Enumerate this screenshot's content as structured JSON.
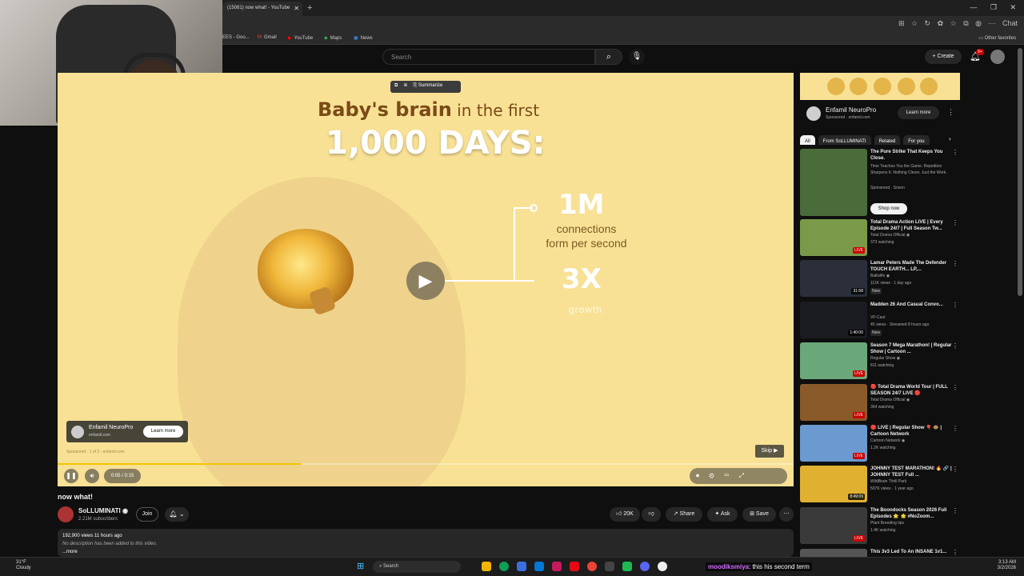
{
  "browser": {
    "tab_title": "(15081) now what! - YouTube",
    "new_tab": "+",
    "window_controls": "— ❐ ✕",
    "bookmarks": [
      {
        "label": "EES - Goo..."
      },
      {
        "label": "Gmail"
      },
      {
        "label": "YouTube"
      },
      {
        "label": "Maps"
      },
      {
        "label": "News"
      }
    ],
    "other_favorites": "Other favorites",
    "copilot_label": "Chat"
  },
  "header": {
    "search_placeholder": "Search",
    "create_label": "+ Create",
    "notification_count": "9+"
  },
  "video": {
    "toolbar": [
      "⧉",
      "⧈",
      "⎘ Summarize"
    ],
    "headline_bold": "Baby's brain",
    "headline_rest": " in the first",
    "big_title": "1,000 DAYS:",
    "stat1_value": "1M",
    "stat1_line1": "connections",
    "stat1_line2": "form per second",
    "stat2_value": "3X",
    "stat2_label": "growth",
    "ad_name": "Enfamil NeuroPro",
    "ad_url": "enfamil.com",
    "ad_learn": "Learn more",
    "ad_info": "Sponsored · 1 of 2 · enfamil.com",
    "skip_label": "Skip ▶",
    "time": "0:05 / 0:15",
    "progress_fraction": 0.33
  },
  "below": {
    "title": "now what!",
    "channel_name": "SoLLUMINATI ◉",
    "subscribers": "2.21M subscribers",
    "join": "Join",
    "bell": "🔔︎ ⌄",
    "like": "👍︎ 20K",
    "dislike": "👎︎",
    "share": "↗ Share",
    "ask": "✦ Ask",
    "save": "⊞ Save",
    "more": "⋯",
    "desc_views": "192,900 views  11 hours ago",
    "desc_text": "No description has been added to this video.",
    "desc_more": "...more"
  },
  "sidebar": {
    "ad_name": "Enfamil NeuroPro",
    "ad_sponsored": "Sponsored · enfamil.com",
    "ad_learn": "Learn more",
    "chips": [
      "All",
      "From SoLLUMINATI",
      "Related",
      "For you"
    ],
    "cards": [
      {
        "title": "The Pure Strike That Keeps You Close.",
        "channel": "Time Teaches You the Game. Repetition Sharpens It. Nothing Clever. Just the Work.",
        "meta": "Sponsored · Srixon",
        "badge": "Shop now",
        "dur": ""
      },
      {
        "title": "Total Drama Action LIVE | Every Episode 24/7 | Full Season Tw...",
        "channel": "Total Drama Official ◉",
        "meta": "373 watching",
        "badge": "",
        "dur": "LIVE"
      },
      {
        "title": "Lamar Peters Made The Defender TOUCH EARTH... LP,...",
        "channel": "Ballislife ◉",
        "meta": "111K views · 1 day ago",
        "badge": "New",
        "dur": "31:58"
      },
      {
        "title": "Madden 26 And Casual Convo...",
        "channel": "VF-Cast",
        "meta": "45 views · Streamed 8 hours ago",
        "badge": "New",
        "dur": "1:40:00"
      },
      {
        "title": "Season 7 Mega Marathon! | Regular Show | Cartoon ...",
        "channel": "Regular Show ◉",
        "meta": "811 watching",
        "badge": "",
        "dur": "LIVE"
      },
      {
        "title": "🔴 Total Drama World Tour | FULL SEASON 24/7 LIVE 🔴",
        "channel": "Total Drama Official ◉",
        "meta": "364 watching",
        "badge": "",
        "dur": "LIVE"
      },
      {
        "title": "🔴 LIVE | Regular Show 🎈 🐵 | Cartoon Network",
        "channel": "Cartoon Network ◉",
        "meta": "1.2K watching",
        "badge": "",
        "dur": "LIVE"
      },
      {
        "title": "JOHNNY TEST MARATHON! 🔥 🔗 | JOHNNY TEST Full ...",
        "channel": "WildBrain Thrill Park",
        "meta": "507K views · 1 year ago",
        "badge": "",
        "dur": "8:49:09"
      },
      {
        "title": "The Boondocks Season 2026 Full Episodes 🌟 🌟 #NoZoom...",
        "channel": "Plant Breeding tips",
        "meta": "1.4K watching",
        "badge": "",
        "dur": "LIVE"
      },
      {
        "title": "This 3v3 Led To An INSANE 1v1...",
        "channel": "",
        "meta": "",
        "badge": "",
        "dur": ""
      }
    ]
  },
  "taskbar": {
    "weather_temp": "31°F",
    "weather_desc": "Cloudy",
    "search": "Search",
    "time": "3:13 AM",
    "date": "3/2/2026",
    "chat_user": "moodiksmiya",
    "chat_msg": ": this his second term"
  },
  "colors": {
    "video_bg": "#f8e195",
    "brand_text": "#7a4a17",
    "yt_red": "#cc0000",
    "progress": "#f5c400"
  }
}
